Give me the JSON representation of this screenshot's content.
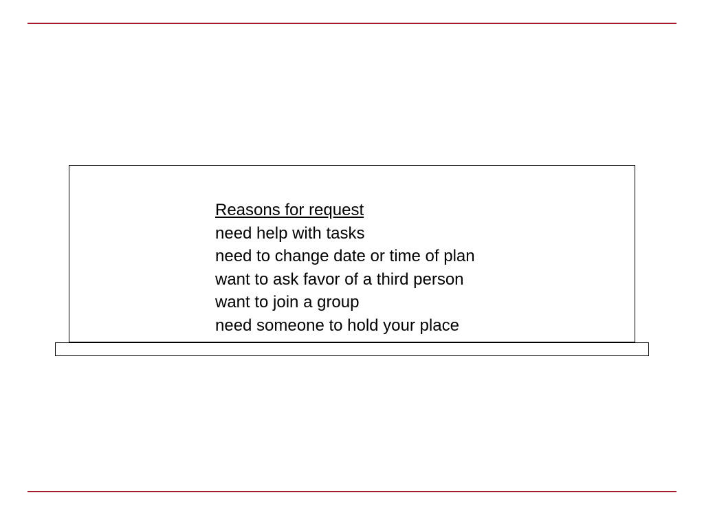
{
  "heading": "Reasons for request",
  "lines": {
    "l1": "need help with tasks",
    "l2": "need to change date or time of plan",
    "l3": "want to ask favor of a third person",
    "l4": "want to join a group",
    "l5": "need someone to hold your place"
  },
  "colors": {
    "rule": "#a6192e"
  }
}
